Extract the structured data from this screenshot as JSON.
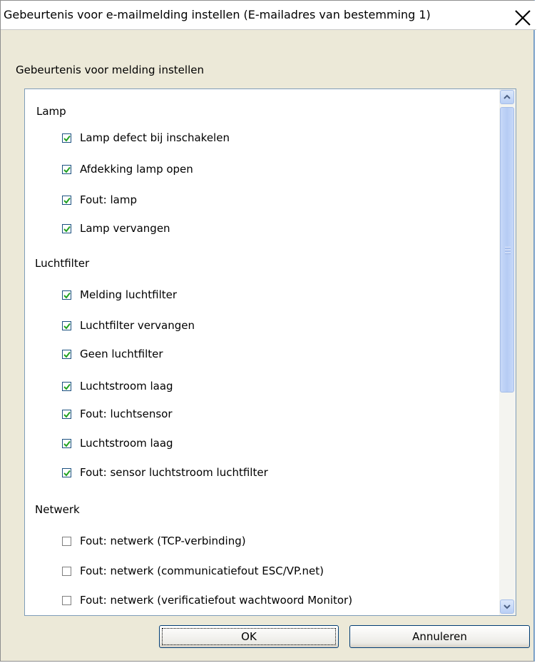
{
  "window": {
    "title": "Gebeurtenis voor e-mailmelding instellen (E-mailadres van bestemming 1)",
    "close_icon": "close-icon"
  },
  "caption": "Gebeurtenis voor melding instellen",
  "groups": [
    {
      "label": "Lamp",
      "items": [
        {
          "label": "Lamp defect bij inschakelen",
          "checked": true
        },
        {
          "label": "Afdekking lamp open",
          "checked": true
        },
        {
          "label": "Fout: lamp",
          "checked": true
        },
        {
          "label": "Lamp vervangen",
          "checked": true
        }
      ]
    },
    {
      "label": "Luchtfilter",
      "items": [
        {
          "label": "Melding luchtfilter",
          "checked": true
        },
        {
          "label": "Luchtfilter vervangen",
          "checked": true
        },
        {
          "label": "Geen luchtfilter",
          "checked": true
        },
        {
          "label": "Luchtstroom laag",
          "checked": true
        },
        {
          "label": "Fout: luchtsensor",
          "checked": true
        },
        {
          "label": "Luchtstroom laag",
          "checked": true
        },
        {
          "label": "Fout: sensor luchtstroom luchtfilter",
          "checked": true
        }
      ]
    },
    {
      "label": "Netwerk",
      "items": [
        {
          "label": "Fout: netwerk (TCP-verbinding)",
          "checked": false
        },
        {
          "label": "Fout: netwerk (communicatiefout ESC/VP.net)",
          "checked": false
        },
        {
          "label": "Fout: netwerk (verificatiefout wachtwoord Monitor)",
          "checked": false
        }
      ]
    }
  ],
  "buttons": {
    "ok": "OK",
    "cancel": "Annuleren"
  }
}
